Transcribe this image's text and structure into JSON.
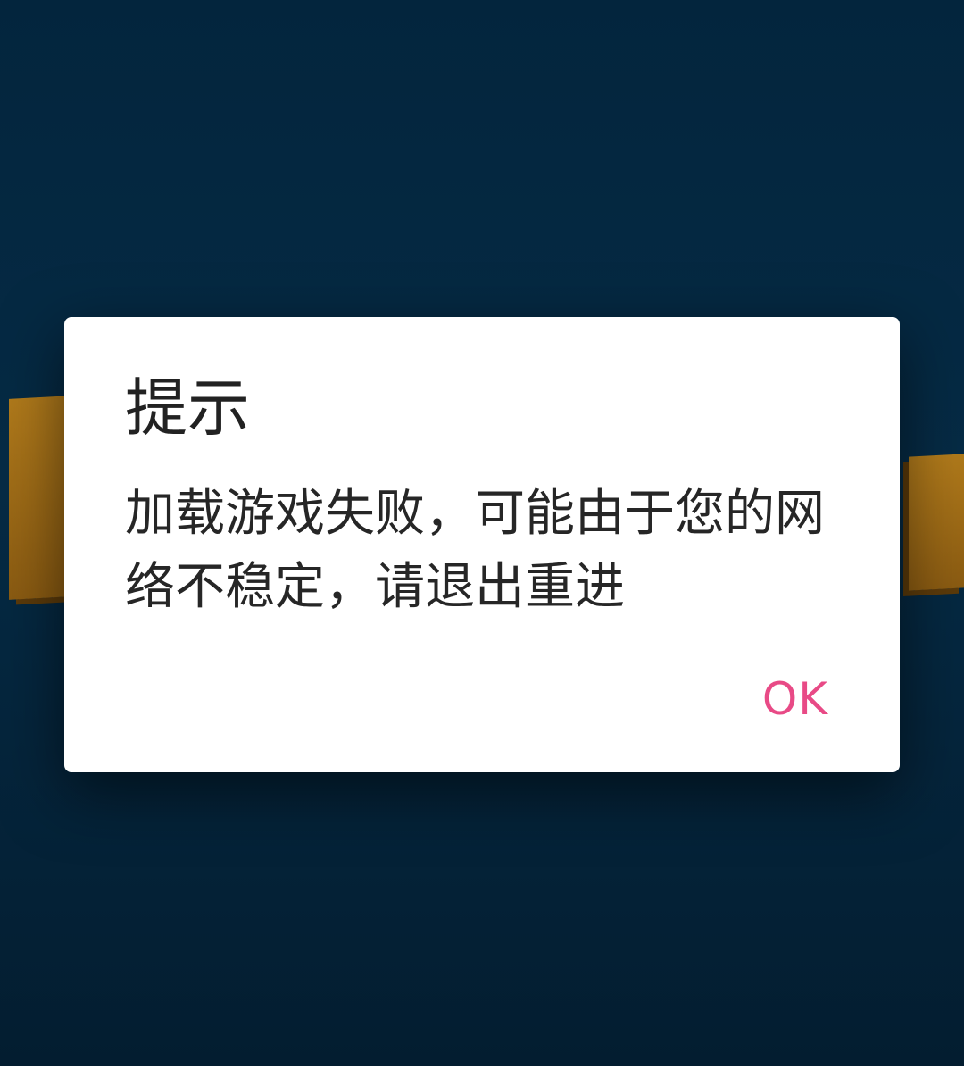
{
  "dialog": {
    "title": "提示",
    "message": "加载游戏失败，可能由于您的网络不稳定，请退出重进",
    "ok_label": "OK"
  },
  "colors": {
    "background": "#062b45",
    "dialog_background": "#ffffff",
    "accent": "#e84a86",
    "logo": "#a06e19"
  }
}
